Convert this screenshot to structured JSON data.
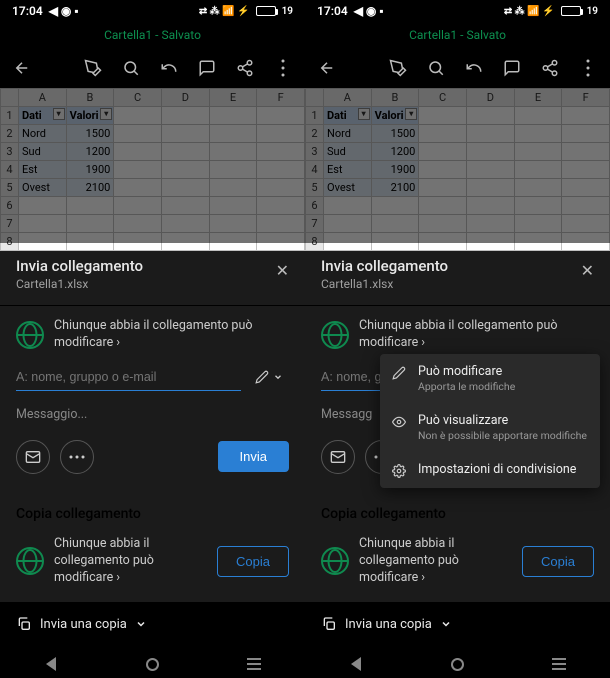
{
  "status": {
    "time": "17:04",
    "battery_pct": "19"
  },
  "doc": {
    "title_line": "Cartella1 - Salvato",
    "filename": "Cartella1.xlsx"
  },
  "sheet": {
    "cols": [
      "A",
      "B",
      "C",
      "D",
      "E",
      "F"
    ],
    "headers": {
      "a": "Dati",
      "b": "Valori"
    },
    "rows": [
      {
        "a": "Nord",
        "b": "1500"
      },
      {
        "a": "Sud",
        "b": "1200"
      },
      {
        "a": "Est",
        "b": "1900"
      },
      {
        "a": "Ovest",
        "b": "2100"
      }
    ]
  },
  "share": {
    "title": "Invia collegamento",
    "access_text": "Chiunque abbia il collegamento può modificare ›",
    "to_placeholder": "A: nome, gruppo o e-mail",
    "message_placeholder": "Messaggio...",
    "send_label": "Invia"
  },
  "dropdown": {
    "edit_title": "Può modificare",
    "edit_sub": "Apporta le modifiche",
    "view_title": "Può visualizzare",
    "view_sub": "Non è possibile apportare modifiche",
    "settings": "Impostazioni di condivisione"
  },
  "copy": {
    "header": "Copia collegamento",
    "access_text": "Chiunque abbia il collegamento può modificare ›",
    "button": "Copia"
  },
  "footer": {
    "send_copy": "Invia una copia"
  }
}
